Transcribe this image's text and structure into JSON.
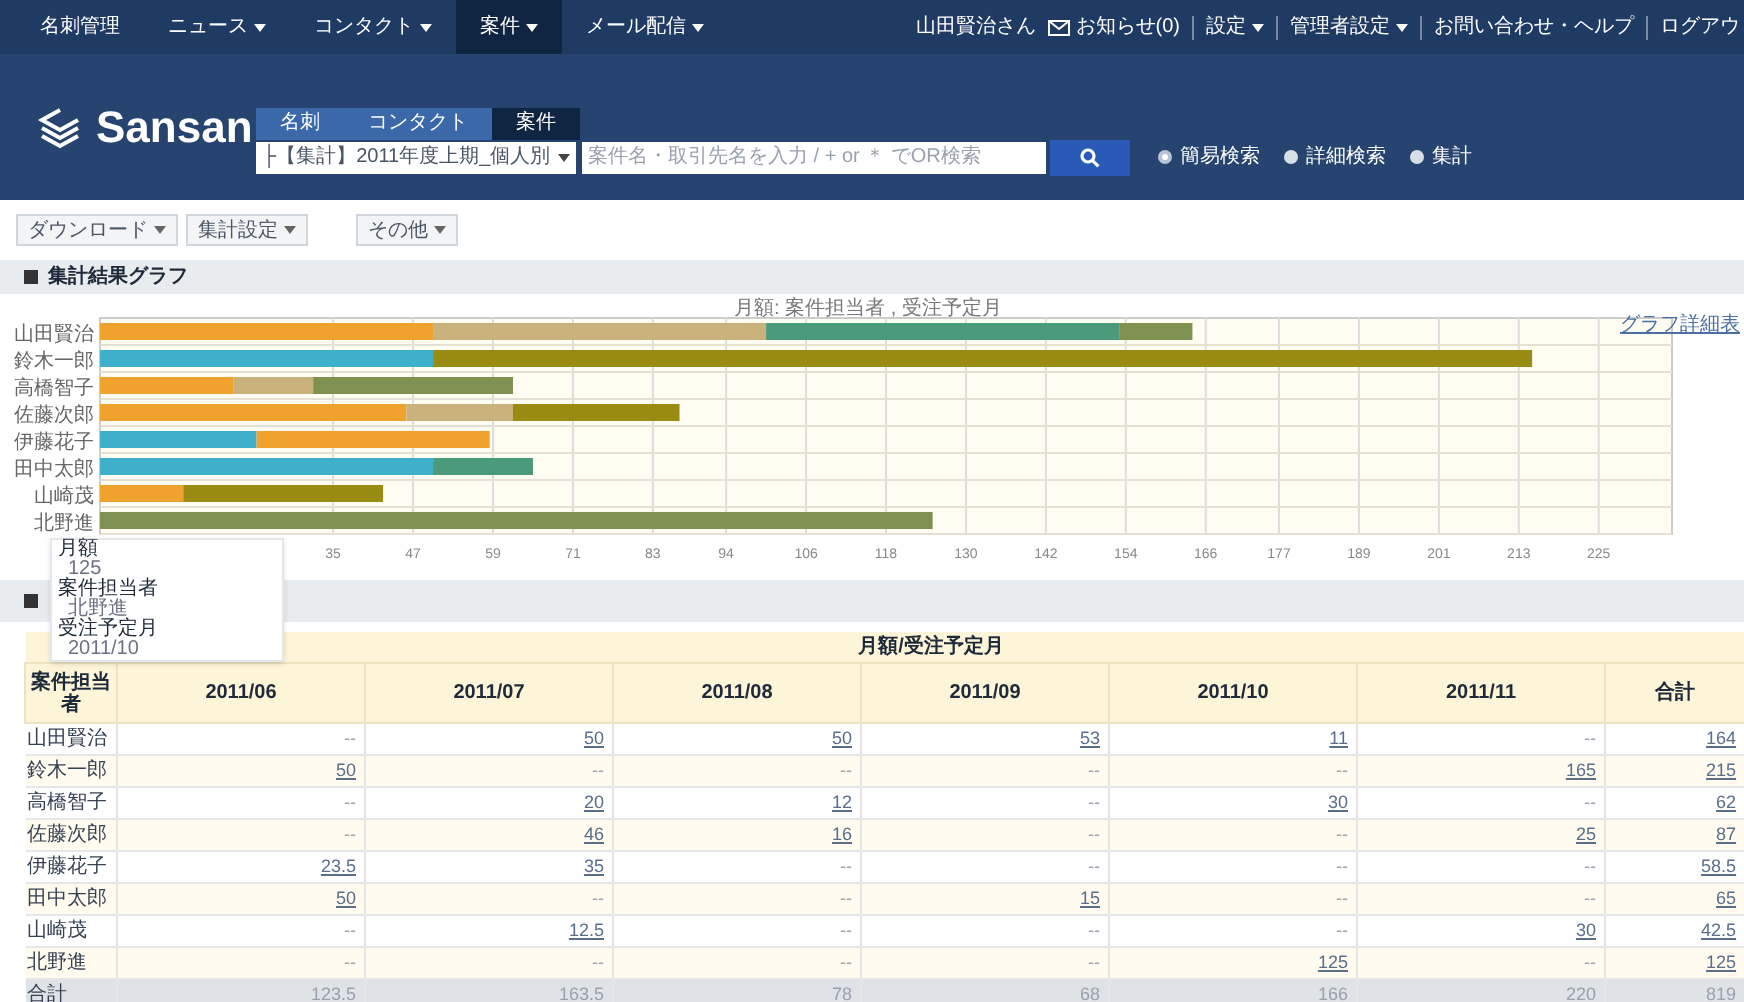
{
  "nav": {
    "items": [
      {
        "label": "名刺管理",
        "dropdown": false,
        "selected": false
      },
      {
        "label": "ニュース",
        "dropdown": true,
        "selected": false
      },
      {
        "label": "コンタクト",
        "dropdown": true,
        "selected": false
      },
      {
        "label": "案件",
        "dropdown": true,
        "selected": true
      },
      {
        "label": "メール配信",
        "dropdown": true,
        "selected": false
      }
    ],
    "user": "山田賢治さん",
    "notices": "お知らせ(0)",
    "right_links": [
      {
        "label": "設定",
        "dropdown": true
      },
      {
        "label": "管理者設定",
        "dropdown": true
      },
      {
        "label": "お問い合わせ・ヘルプ",
        "dropdown": false
      },
      {
        "label": "ログアウ",
        "dropdown": false
      }
    ]
  },
  "header": {
    "logo": "Sansan",
    "search_tabs": [
      {
        "label": "名刺",
        "selected": false
      },
      {
        "label": "コンタクト",
        "selected": false
      },
      {
        "label": "案件",
        "selected": true
      }
    ],
    "saved_search": "├【集計】2011年度上期_個人別",
    "search": {
      "placeholder": "案件名・取引先名を入力 / + or ＊ でOR検索"
    },
    "modes": [
      {
        "label": "簡易検索",
        "selected": true
      },
      {
        "label": "詳細検索",
        "selected": false
      },
      {
        "label": "集計",
        "selected": false
      }
    ]
  },
  "toolbar": [
    "ダウンロード",
    "集計設定",
    "その他"
  ],
  "graph_section": {
    "title": "集計結果グラフ",
    "link": "グラフ詳細表",
    "chart_data": {
      "type": "bar",
      "orientation": "horizontal",
      "stacked": true,
      "grid": true,
      "title": "月額: 案件担当者 , 受注予定月",
      "categories": [
        "山田賢治",
        "鈴木一郎",
        "高橋智子",
        "佐藤次郎",
        "伊藤花子",
        "田中太郎",
        "山崎茂",
        "北野進"
      ],
      "series": [
        {
          "color": "#3fb0c9",
          "values": [
            null,
            50,
            null,
            null,
            23.5,
            50,
            null,
            null
          ]
        },
        {
          "color": "#f0a22e",
          "values": [
            50,
            null,
            20,
            46,
            35,
            null,
            12.5,
            null
          ]
        },
        {
          "color": "#c9b27c",
          "values": [
            50,
            null,
            12,
            16,
            null,
            null,
            null,
            null
          ]
        },
        {
          "color": "#4c9a7c",
          "values": [
            53,
            null,
            null,
            null,
            null,
            15,
            null,
            null
          ]
        },
        {
          "color": "#7e9150",
          "values": [
            11,
            null,
            30,
            null,
            null,
            null,
            null,
            125
          ]
        },
        {
          "color": "#9a8b12",
          "values": [
            null,
            165,
            null,
            25,
            null,
            null,
            30,
            null
          ]
        }
      ],
      "xlim": [
        0,
        236
      ],
      "xticks": [
        35,
        47,
        59,
        71,
        83,
        94,
        106,
        118,
        130,
        142,
        154,
        166,
        177,
        189,
        201,
        213,
        225
      ]
    },
    "tooltip": [
      {
        "label": "月額",
        "value": "125"
      },
      {
        "label": "案件担当者",
        "value": "北野進"
      },
      {
        "label": "受注予定月",
        "value": "2011/10"
      }
    ]
  },
  "table": {
    "group_header": "月額/受注予定月",
    "corner": "案件担当者",
    "columns": [
      "2011/06",
      "2011/07",
      "2011/08",
      "2011/09",
      "2011/10",
      "2011/11",
      "合計"
    ],
    "rows": [
      {
        "name": "山田賢治",
        "cells": [
          "--",
          "50",
          "50",
          "53",
          "11",
          "--",
          "164"
        ]
      },
      {
        "name": "鈴木一郎",
        "cells": [
          "50",
          "--",
          "--",
          "--",
          "--",
          "165",
          "215"
        ]
      },
      {
        "name": "高橋智子",
        "cells": [
          "--",
          "20",
          "12",
          "--",
          "30",
          "--",
          "62"
        ]
      },
      {
        "name": "佐藤次郎",
        "cells": [
          "--",
          "46",
          "16",
          "--",
          "--",
          "25",
          "87"
        ]
      },
      {
        "name": "伊藤花子",
        "cells": [
          "23.5",
          "35",
          "--",
          "--",
          "--",
          "--",
          "58.5"
        ]
      },
      {
        "name": "田中太郎",
        "cells": [
          "50",
          "--",
          "--",
          "15",
          "--",
          "--",
          "65"
        ]
      },
      {
        "name": "山崎茂",
        "cells": [
          "--",
          "12.5",
          "--",
          "--",
          "--",
          "30",
          "42.5"
        ]
      },
      {
        "name": "北野進",
        "cells": [
          "--",
          "--",
          "--",
          "--",
          "125",
          "--",
          "125"
        ]
      }
    ],
    "total": {
      "name": "合計",
      "cells": [
        "123.5",
        "163.5",
        "78",
        "68",
        "166",
        "220",
        "819"
      ]
    }
  }
}
